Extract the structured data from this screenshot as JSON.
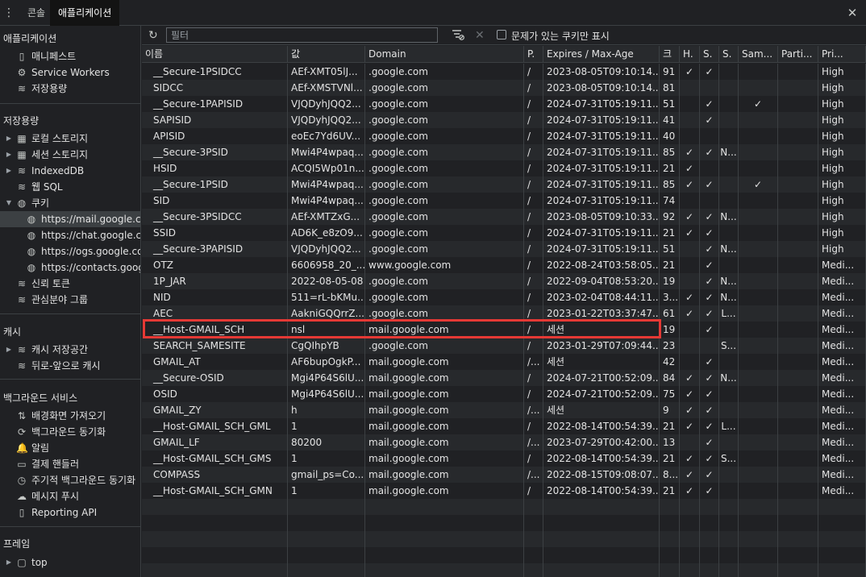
{
  "topbar": {
    "tabs": [
      {
        "label": "콘솔",
        "active": false
      },
      {
        "label": "애플리케이션",
        "active": true
      }
    ]
  },
  "sidebar": {
    "sections": {
      "application": "애플리케이션",
      "storage": "저장용량",
      "cache": "캐시",
      "background": "백그라운드 서비스",
      "frames": "프레임"
    },
    "application_items": [
      {
        "label": "매니페스트",
        "icon": "document-icon"
      },
      {
        "label": "Service Workers",
        "icon": "gear-icon"
      },
      {
        "label": "저장용량",
        "icon": "database-icon"
      }
    ],
    "storage_items": [
      {
        "label": "로컬 스토리지",
        "icon": "grid-icon",
        "expandable": true
      },
      {
        "label": "세션 스토리지",
        "icon": "grid-icon",
        "expandable": true
      },
      {
        "label": "IndexedDB",
        "icon": "database-icon",
        "expandable": true
      },
      {
        "label": "웹 SQL",
        "icon": "database-icon",
        "expandable": false
      },
      {
        "label": "쿠키",
        "icon": "cookie-icon",
        "expandable": true,
        "expanded": true
      }
    ],
    "cookie_sites": [
      {
        "label": "https://mail.google.com",
        "selected": true
      },
      {
        "label": "https://chat.google.com",
        "selected": false
      },
      {
        "label": "https://ogs.google.com",
        "selected": false
      },
      {
        "label": "https://contacts.google.com",
        "selected": false
      }
    ],
    "storage_more": [
      {
        "label": "신뢰 토큰",
        "icon": "database-icon"
      },
      {
        "label": "관심분야 그룹",
        "icon": "database-icon"
      }
    ],
    "cache_items": [
      {
        "label": "캐시 저장공간",
        "icon": "database-icon",
        "expandable": true
      },
      {
        "label": "뒤로-앞으로 캐시",
        "icon": "database-icon",
        "expandable": false
      }
    ],
    "background_items": [
      {
        "label": "배경화면 가져오기",
        "icon": "transfer-icon"
      },
      {
        "label": "백그라운드 동기화",
        "icon": "sync-icon"
      },
      {
        "label": "알림",
        "icon": "bell-icon"
      },
      {
        "label": "결제 핸들러",
        "icon": "card-icon"
      },
      {
        "label": "주기적 백그라운드 동기화",
        "icon": "clock-icon"
      },
      {
        "label": "메시지 푸시",
        "icon": "cloud-icon"
      },
      {
        "label": "Reporting API",
        "icon": "document-icon"
      }
    ],
    "frame_items": [
      {
        "label": "top",
        "icon": "frame-icon",
        "expandable": true
      }
    ]
  },
  "toolbar": {
    "filter_placeholder": "필터",
    "filter_value": "",
    "issue_cookies_label": "문제가 있는 쿠키만 표시",
    "issue_cookies_checked": false
  },
  "table": {
    "columns": [
      "이름",
      "값",
      "Domain",
      "P.",
      "Expires / Max-Age",
      "크",
      "H.",
      "S.",
      "S.",
      "Sam...",
      "Parti...",
      "Pri..."
    ],
    "highlighted_row": 16,
    "rows": [
      [
        "__Secure-1PSIDCC",
        "AEf-XMT05lJ...",
        ".google.com",
        "/",
        "2023-08-05T09:10:14...",
        "91",
        "✓",
        "✓",
        "",
        "",
        "",
        "High"
      ],
      [
        "SIDCC",
        "AEf-XMSTVNl...",
        ".google.com",
        "/",
        "2023-08-05T09:10:14...",
        "81",
        "",
        "",
        "",
        "",
        "",
        "High"
      ],
      [
        "__Secure-1PAPISID",
        "VJQDyhJQQ2...",
        ".google.com",
        "/",
        "2024-07-31T05:19:11...",
        "51",
        "",
        "✓",
        "",
        "✓",
        "",
        "High"
      ],
      [
        "SAPISID",
        "VJQDyhJQQ2...",
        ".google.com",
        "/",
        "2024-07-31T05:19:11...",
        "41",
        "",
        "✓",
        "",
        "",
        "",
        "High"
      ],
      [
        "APISID",
        "eoEc7Yd6UV...",
        ".google.com",
        "/",
        "2024-07-31T05:19:11...",
        "40",
        "",
        "",
        "",
        "",
        "",
        "High"
      ],
      [
        "__Secure-3PSID",
        "Mwi4P4wpaq...",
        ".google.com",
        "/",
        "2024-07-31T05:19:11...",
        "85",
        "✓",
        "✓",
        "N...",
        "",
        "",
        "High"
      ],
      [
        "HSID",
        "ACQI5Wp01n...",
        ".google.com",
        "/",
        "2024-07-31T05:19:11...",
        "21",
        "✓",
        "",
        "",
        "",
        "",
        "High"
      ],
      [
        "__Secure-1PSID",
        "Mwi4P4wpaq...",
        ".google.com",
        "/",
        "2024-07-31T05:19:11...",
        "85",
        "✓",
        "✓",
        "",
        "✓",
        "",
        "High"
      ],
      [
        "SID",
        "Mwi4P4wpaq...",
        ".google.com",
        "/",
        "2024-07-31T05:19:11...",
        "74",
        "",
        "",
        "",
        "",
        "",
        "High"
      ],
      [
        "__Secure-3PSIDCC",
        "AEf-XMTZxG...",
        ".google.com",
        "/",
        "2023-08-05T09:10:33...",
        "92",
        "✓",
        "✓",
        "N...",
        "",
        "",
        "High"
      ],
      [
        "SSID",
        "AD6K_e8zO9...",
        ".google.com",
        "/",
        "2024-07-31T05:19:11...",
        "21",
        "✓",
        "✓",
        "",
        "",
        "",
        "High"
      ],
      [
        "__Secure-3PAPISID",
        "VJQDyhJQQ2...",
        ".google.com",
        "/",
        "2024-07-31T05:19:11...",
        "51",
        "",
        "✓",
        "N...",
        "",
        "",
        "High"
      ],
      [
        "OTZ",
        "6606958_20_...",
        "www.google.com",
        "/",
        "2022-08-24T03:58:05...",
        "21",
        "",
        "✓",
        "",
        "",
        "",
        "Medi..."
      ],
      [
        "1P_JAR",
        "2022-08-05-08",
        ".google.com",
        "/",
        "2022-09-04T08:53:20...",
        "19",
        "",
        "✓",
        "N...",
        "",
        "",
        "Medi..."
      ],
      [
        "NID",
        "511=rL-bKMu...",
        ".google.com",
        "/",
        "2023-02-04T08:44:11...",
        "3...",
        "✓",
        "✓",
        "N...",
        "",
        "",
        "Medi..."
      ],
      [
        "AEC",
        "AakniGQQrrZ...",
        ".google.com",
        "/",
        "2023-01-22T03:37:47...",
        "61",
        "✓",
        "✓",
        "L...",
        "",
        "",
        "Medi..."
      ],
      [
        "__Host-GMAIL_SCH",
        "nsl",
        "mail.google.com",
        "/",
        "세션",
        "19",
        "",
        "✓",
        "",
        "",
        "",
        "Medi..."
      ],
      [
        "SEARCH_SAMESITE",
        "CgQIhpYB",
        ".google.com",
        "/",
        "2023-01-29T07:09:44...",
        "23",
        "",
        "",
        "S...",
        "",
        "",
        "Medi..."
      ],
      [
        "GMAIL_AT",
        "AF6bupOgkP...",
        "mail.google.com",
        "/...",
        "세션",
        "42",
        "",
        "✓",
        "",
        "",
        "",
        "Medi..."
      ],
      [
        "__Secure-OSID",
        "Mgi4P64S6lU...",
        "mail.google.com",
        "/",
        "2024-07-21T00:52:09...",
        "84",
        "✓",
        "✓",
        "N...",
        "",
        "",
        "Medi..."
      ],
      [
        "OSID",
        "Mgi4P64S6lU...",
        "mail.google.com",
        "/",
        "2024-07-21T00:52:09...",
        "75",
        "✓",
        "✓",
        "",
        "",
        "",
        "Medi..."
      ],
      [
        "GMAIL_ZY",
        "h",
        "mail.google.com",
        "/...",
        "세션",
        "9",
        "✓",
        "✓",
        "",
        "",
        "",
        "Medi..."
      ],
      [
        "__Host-GMAIL_SCH_GML",
        "1",
        "mail.google.com",
        "/",
        "2022-08-14T00:54:39...",
        "21",
        "✓",
        "✓",
        "L...",
        "",
        "",
        "Medi..."
      ],
      [
        "GMAIL_LF",
        "80200",
        "mail.google.com",
        "/...",
        "2023-07-29T00:42:00...",
        "13",
        "",
        "✓",
        "",
        "",
        "",
        "Medi..."
      ],
      [
        "__Host-GMAIL_SCH_GMS",
        "1",
        "mail.google.com",
        "/",
        "2022-08-14T00:54:39...",
        "21",
        "✓",
        "✓",
        "S...",
        "",
        "",
        "Medi..."
      ],
      [
        "COMPASS",
        "gmail_ps=Co...",
        "mail.google.com",
        "/...",
        "2022-08-15T09:08:07...",
        "8...",
        "✓",
        "✓",
        "",
        "",
        "",
        "Medi..."
      ],
      [
        "__Host-GMAIL_SCH_GMN",
        "1",
        "mail.google.com",
        "/",
        "2022-08-14T00:54:39...",
        "21",
        "✓",
        "✓",
        "",
        "",
        "",
        "Medi..."
      ]
    ]
  },
  "colors": {
    "highlight_border": "#e53935",
    "panel_bg": "#202124"
  }
}
